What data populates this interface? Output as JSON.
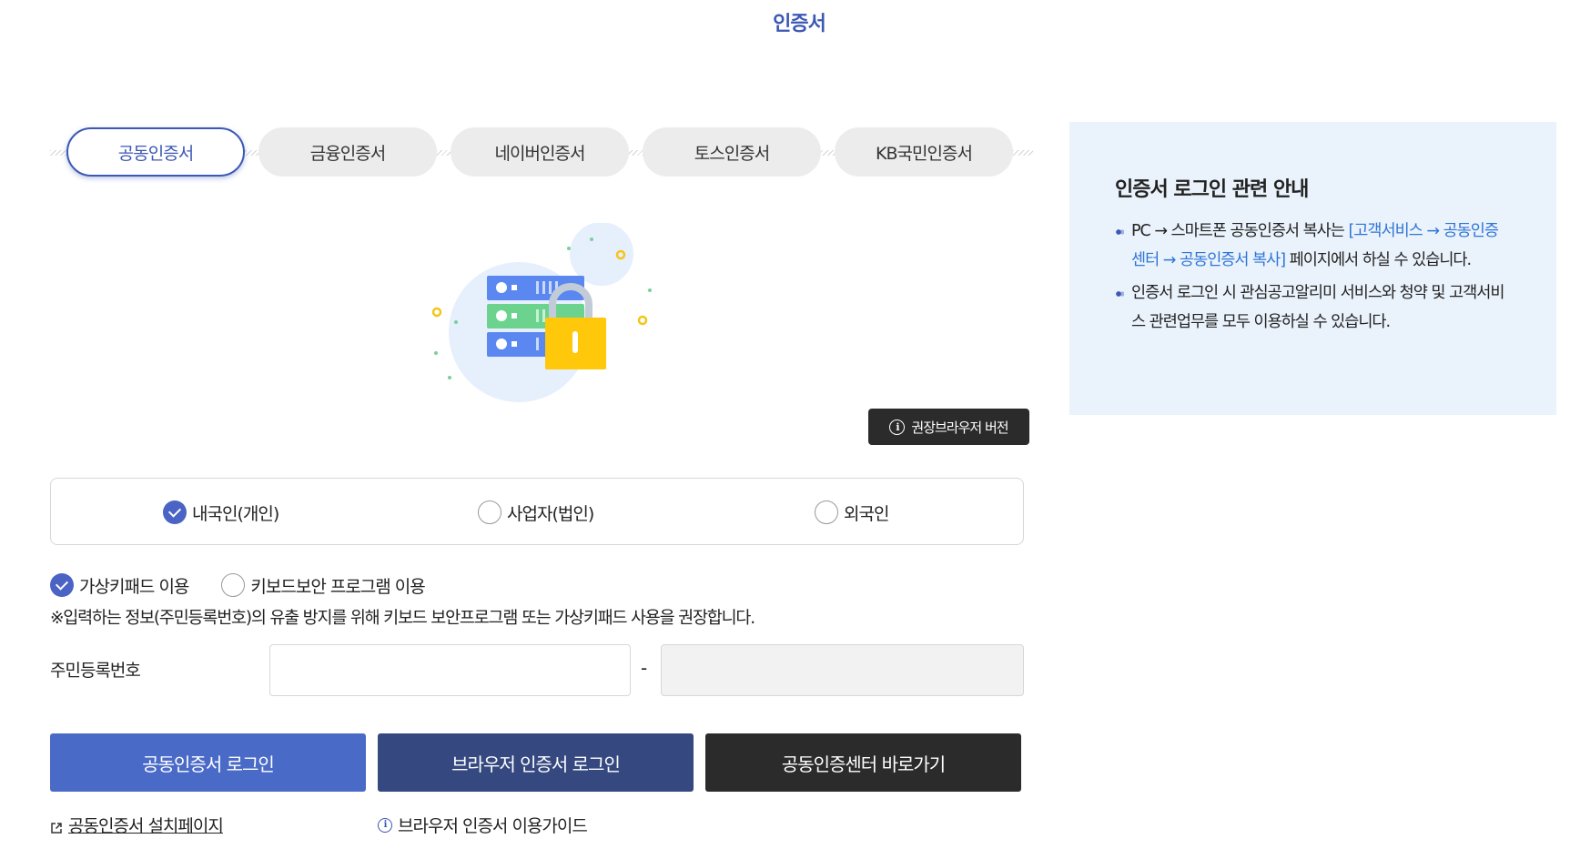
{
  "page": {
    "title": "인증서"
  },
  "tabs": [
    {
      "label": "공동인증서",
      "active": true
    },
    {
      "label": "금융인증서",
      "active": false
    },
    {
      "label": "네이버인증서",
      "active": false
    },
    {
      "label": "토스인증서",
      "active": false
    },
    {
      "label": "KB국민인증서",
      "active": false
    }
  ],
  "illustration": {
    "icon": "server-lock-illustration"
  },
  "browser_version_button": {
    "label": "권장브라우저 버전",
    "icon": "info-icon"
  },
  "user_type": {
    "options": [
      {
        "label": "내국인(개인)",
        "checked": true
      },
      {
        "label": "사업자(법인)",
        "checked": false
      },
      {
        "label": "외국인",
        "checked": false
      }
    ]
  },
  "keypad": {
    "options": [
      {
        "label": "가상키패드 이용",
        "checked": true
      },
      {
        "label": "키보드보안 프로그램 이용",
        "checked": false
      }
    ],
    "notice": "※입력하는 정보(주민등록번호)의 유출 방지를 위해 키보드 보안프로그램 또는 가상키패드 사용을 권장합니다."
  },
  "resident_id": {
    "label": "주민등록번호",
    "separator": "-",
    "first_value": "",
    "second_value": ""
  },
  "buttons": {
    "cert_login": "공동인증서 로그인",
    "browser_cert_login": "브라우저 인증서 로그인",
    "cert_center": "공동인증센터 바로가기"
  },
  "links": {
    "install_page": "공동인증서 설치페이지",
    "browser_guide": "브라우저 인증서 이용가이드"
  },
  "info_panel": {
    "title": "인증서 로그인 관련 안내",
    "item1_prefix": "PC → 스마트폰 공동인증서 복사는 ",
    "item1_link": "[고객서비스 → 공동인증센터 → 공동인증서 복사]",
    "item1_suffix": " 페이지에서 하실 수 있습니다.",
    "item2": "인증서 로그인 시 관심공고알리미 서비스와 청약 및 고객서비스 관련업무를 모두 이용하실 수 있습니다."
  },
  "colors": {
    "primary": "#3c58b4",
    "button_blue": "#4a6ac8",
    "button_navy": "#35487f",
    "button_dark": "#2b2b2b",
    "panel_bg": "#eaf2fb",
    "link": "#2f75d6"
  }
}
